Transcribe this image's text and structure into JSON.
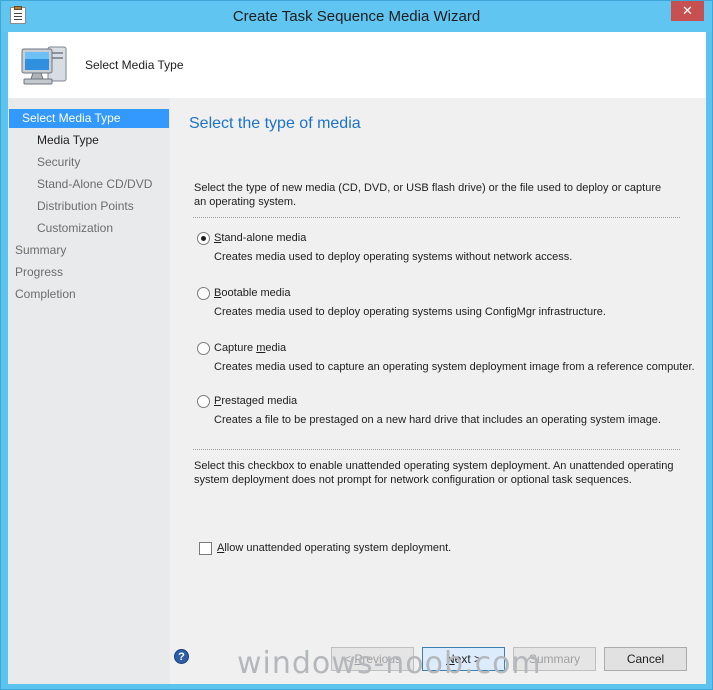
{
  "window": {
    "title": "Create Task Sequence Media Wizard",
    "close_glyph": "✕"
  },
  "header": {
    "title": "Select Media Type"
  },
  "sidebar": {
    "items": [
      {
        "label": "Select Media Type",
        "level": "top",
        "state": "active"
      },
      {
        "label": "Media Type",
        "level": "sub",
        "state": "current"
      },
      {
        "label": "Security",
        "level": "sub",
        "state": "normal"
      },
      {
        "label": "Stand-Alone CD/DVD",
        "level": "sub",
        "state": "normal"
      },
      {
        "label": "Distribution Points",
        "level": "sub",
        "state": "normal"
      },
      {
        "label": "Customization",
        "level": "sub",
        "state": "normal"
      },
      {
        "label": "Summary",
        "level": "top",
        "state": "normal"
      },
      {
        "label": "Progress",
        "level": "top",
        "state": "normal"
      },
      {
        "label": "Completion",
        "level": "top",
        "state": "normal"
      }
    ]
  },
  "main": {
    "heading": "Select the type of media",
    "description": "Select the type of new media (CD, DVD, or USB flash drive) or the file used to deploy or capture an operating system.",
    "options": [
      {
        "accel": "S",
        "label_rest": "tand-alone media",
        "description": "Creates media used to deploy operating systems without network access.",
        "selected": true
      },
      {
        "accel": "B",
        "label_rest": "ootable media",
        "description": "Creates media used to deploy operating systems using ConfigMgr infrastructure.",
        "selected": false
      },
      {
        "label_pre": "Capture ",
        "accel": "m",
        "label_rest": "edia",
        "description": "Creates media used to capture an operating system deployment image from a reference computer.",
        "selected": false
      },
      {
        "accel": "P",
        "label_rest": "restaged media",
        "description": "Creates a file to be prestaged on a new hard drive that includes an operating system image.",
        "selected": false
      }
    ],
    "unattended_note": "Select this checkbox to enable unattended operating system deployment. An unattended operating system deployment does not prompt for network configuration or optional task sequences.",
    "unattended_checkbox": {
      "accel": "A",
      "label_rest": "llow unattended operating system deployment.",
      "checked": false
    }
  },
  "footer": {
    "help_glyph": "?",
    "previous": {
      "pre": "< ",
      "accel": "P",
      "rest": "revious",
      "enabled": false
    },
    "next": {
      "accel": "N",
      "rest": "ext >",
      "enabled": true
    },
    "summary": {
      "label": "Summary",
      "enabled": false
    },
    "cancel": {
      "label": "Cancel",
      "enabled": true
    }
  },
  "watermark": "windows-noob.com",
  "colors": {
    "titlebar": "#60c5f1",
    "accent_heading": "#1e73c8",
    "nav_active": "#3399ff",
    "close": "#c75050"
  }
}
